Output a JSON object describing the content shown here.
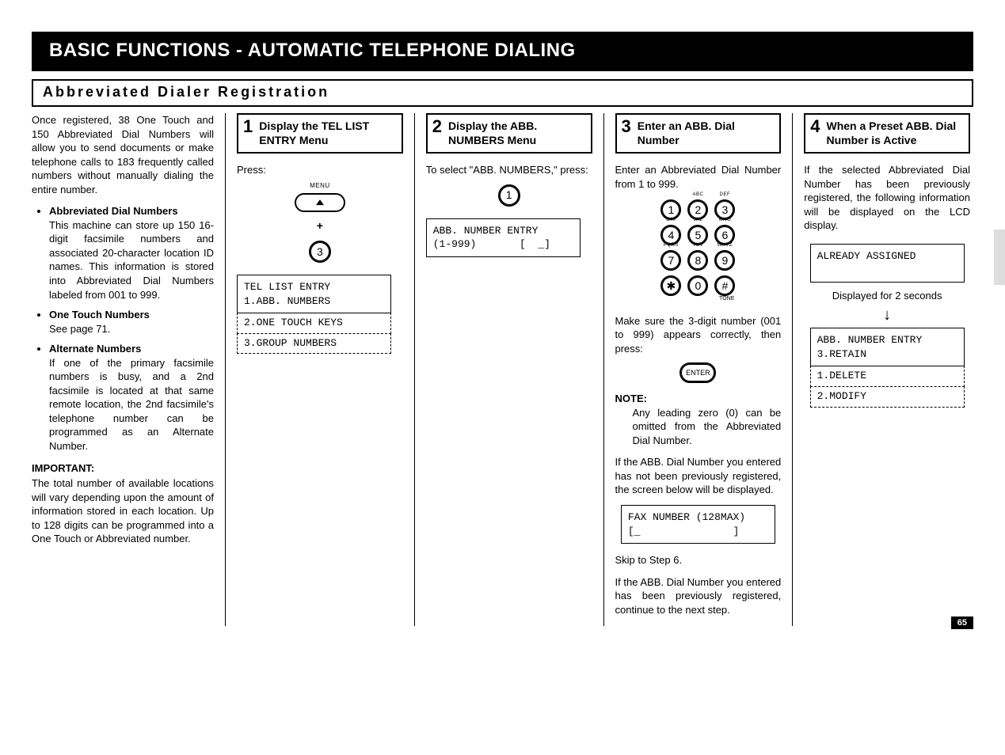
{
  "header": {
    "title": "BASIC FUNCTIONS - AUTOMATIC TELEPHONE DIALING"
  },
  "section_title": "Abbreviated  Dialer  Registration",
  "intro": {
    "para1": "Once registered, 38 One Touch and 150 Abbreviated Dial Numbers will allow you to send documents or make telephone calls to 183 frequently called numbers without manually dialing the entire number.",
    "b1_head": "Abbreviated Dial Numbers",
    "b1_text": "This machine can store up 150 16-digit facsimile numbers and associated 20-character location ID names. This information is stored into Abbreviated Dial Numbers labeled from 001 to 999.",
    "b2_head": "One Touch Numbers",
    "b2_text": "See page 71.",
    "b3_head": "Alternate Numbers",
    "b3_text": "If one of the primary facsimile numbers is busy, and a 2nd facsimile is located at that same remote location, the 2nd facsimile's telephone number can be programmed as an Alternate Number.",
    "imp_head": "IMPORTANT:",
    "imp_text": "The total number of available locations will vary depending upon the amount of information stored in each location. Up to 128 digits can be programmed into a One Touch or Abbreviated number."
  },
  "step1": {
    "num": "1",
    "title": "Display the TEL LIST ENTRY Menu",
    "press": "Press:",
    "menu_label": "MENU",
    "plus": "+",
    "key3": "3",
    "lcd_line1": "TEL LIST ENTRY",
    "lcd_line2": "1.ABB. NUMBERS",
    "dashed2": "2.ONE TOUCH KEYS",
    "dashed3": "3.GROUP NUMBERS"
  },
  "step2": {
    "num": "2",
    "title": "Display the ABB. NUMBERS Menu",
    "text": "To select \"ABB. NUMBERS,\" press:",
    "key1": "1",
    "lcd_line1": "ABB. NUMBER ENTRY",
    "lcd_line2": "(1-999)       [  _]"
  },
  "step3": {
    "num": "3",
    "title": "Enter an ABB. Dial Number",
    "text1": "Enter an Abbreviated Dial Number from 1 to 999.",
    "keypad_letters": {
      "2": "ABC",
      "3": "DEF",
      "4": "GHI",
      "5": "JKL",
      "6": "MNO",
      "7": "PQRS",
      "8": "TUV",
      "9": "WXYZ"
    },
    "tone": "TONE",
    "text2": "Make sure the 3-digit number (001 to 999) appears correctly, then press:",
    "enter_label": "ENTER",
    "note_head": "NOTE:",
    "note_text": "Any leading zero (0) can be omitted from the Abbreviated Dial Number.",
    "text3": "If the ABB. Dial Number you entered has not been previously registered, the screen below will be displayed.",
    "lcd_line1": "FAX NUMBER (128MAX)",
    "lcd_line2": "[_               ]",
    "skip": "Skip to Step 6.",
    "text4": "If the ABB. Dial Number you entered has been previously registered, continue to the next step."
  },
  "step4": {
    "num": "4",
    "title": "When a Preset ABB. Dial Number is Active",
    "text1": "If the selected Abbreviated Dial Number has been  previously registered, the following information will be displayed on the LCD display.",
    "lcd_already": "ALREADY ASSIGNED",
    "wait_text": "Displayed for 2 seconds",
    "lcd_line1": "ABB. NUMBER ENTRY",
    "lcd_line2": "3.RETAIN",
    "dashed1": "1.DELETE",
    "dashed2": "2.MODIFY"
  },
  "page_number": "65"
}
